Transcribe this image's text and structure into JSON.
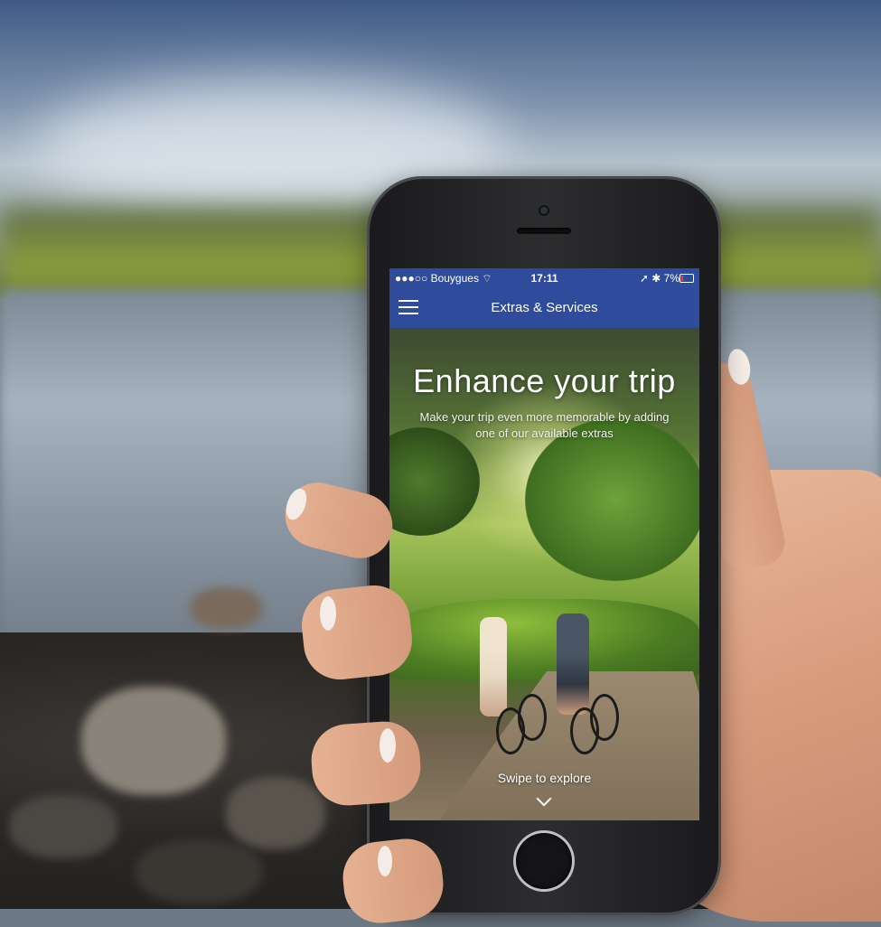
{
  "status_bar": {
    "carrier": "●●●○○ Bouygues ⌔",
    "time": "17:11",
    "right_icons": "➚ ✱ 7%"
  },
  "nav": {
    "menu_icon": "hamburger-menu-icon",
    "title": "Extras & Services"
  },
  "hero": {
    "title": "Enhance your trip",
    "subtitle": "Make your trip even more memorable by adding one of our available extras",
    "swipe_label": "Swipe to explore",
    "swipe_icon": "chevron-down-icon"
  },
  "colors": {
    "nav_bar": "#2f4c9c",
    "text": "#ffffff"
  }
}
